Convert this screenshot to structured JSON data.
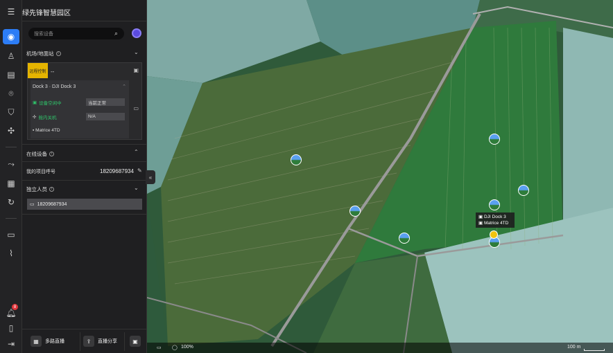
{
  "panel": {
    "title": "绿先锋智慧园区",
    "search_placeholder": "搜索设备"
  },
  "sections": {
    "airport": "机场/地面站",
    "online": "在线设备",
    "independent": "独立人员"
  },
  "dock": {
    "remote_tag": "远程控制",
    "dash": "--",
    "name": "Dock 3 · DJI Dock 3",
    "status1_label": "设备空闲中",
    "status1_value": "当前正常",
    "status2_label": "舱内关机",
    "status2_value": "N/A",
    "drone": "Matrice 4TD"
  },
  "online_device": {
    "callsign_label": "我的项目呼号",
    "callsign_value": "18209687934"
  },
  "independent_person": "18209687934",
  "bottom": {
    "multi_live": "多路直播",
    "live_share": "直播分享"
  },
  "notifications": "8",
  "map": {
    "tooltip_dock": "DJI Dock 3",
    "tooltip_drone": "Matrice 4TD",
    "zoom": "100%",
    "scale": "100 m"
  }
}
